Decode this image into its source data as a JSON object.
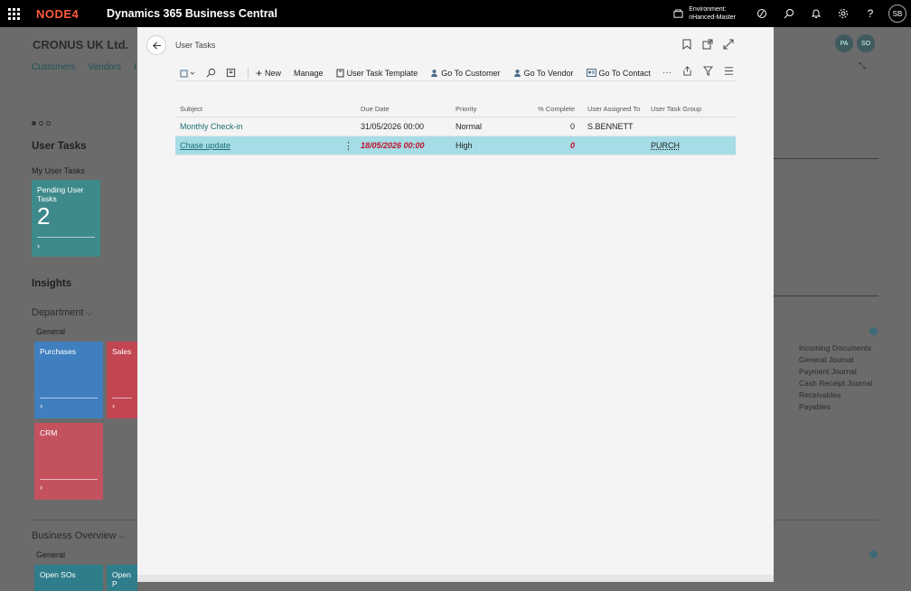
{
  "topbar": {
    "brand": "NODE4",
    "app_title": "Dynamics 365 Business Central",
    "environment_label": "Environment:",
    "environment_name": "nHanced-Master",
    "user_initials": "SB"
  },
  "background": {
    "company": "CRONUS UK Ltd.",
    "nav": [
      "Customers",
      "Vendors",
      "I"
    ],
    "user_tasks_heading": "User Tasks",
    "my_user_tasks": "My User Tasks",
    "pending_tile": {
      "label": "Pending User Tasks",
      "count": "2"
    },
    "insights": "Insights",
    "department": "Department",
    "general": "General",
    "tiles": [
      "Purchases",
      "Sales",
      "CRM"
    ],
    "links": [
      "Incoming Documents",
      "General Journal",
      "Payment Journal",
      "Cash Receipt Journal",
      "Receivables",
      "Payables"
    ],
    "business_overview": "Business Overview",
    "general2": "General",
    "bottom_tiles": [
      "Open SOs",
      "Open P"
    ],
    "avatars": [
      "PA",
      "SO"
    ]
  },
  "dialog": {
    "title": "User Tasks",
    "actions": {
      "new": "New",
      "manage": "Manage",
      "template": "User Task Template",
      "go_customer": "Go To Customer",
      "go_vendor": "Go To Vendor",
      "go_contact": "Go To Contact",
      "more": "···"
    },
    "columns": {
      "subject": "Subject",
      "due": "Due Date",
      "priority": "Priority",
      "pct": "% Complete",
      "user": "User Assigned To",
      "group": "User Task Group"
    },
    "rows": [
      {
        "subject": "Monthly Check-in",
        "due": "31/05/2026 00:00",
        "priority": "Normal",
        "pct": "0",
        "user": "S.BENNETT",
        "group": ""
      },
      {
        "subject": "Chase update",
        "due": "18/05/2026 00:00",
        "priority": "High",
        "pct": "0",
        "user": "",
        "group": "PURCH"
      }
    ]
  }
}
